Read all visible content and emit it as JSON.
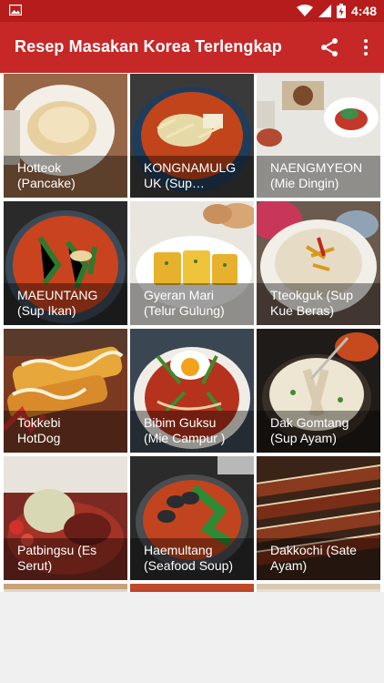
{
  "status_bar": {
    "time": "4:48",
    "icons": [
      "image-icon",
      "wifi-icon",
      "signal-icon",
      "battery-icon"
    ]
  },
  "app_bar": {
    "title": "Resep Masakan Korea Terlengkap",
    "actions": [
      "share-icon",
      "more-vert-icon"
    ]
  },
  "colors": {
    "status_bar": "#b71c1c",
    "app_bar": "#c62828",
    "background": "#f0f0f0"
  },
  "recipes": [
    {
      "label": "Hotteok\n(Pancake)"
    },
    {
      "label": "KONGNAMULG\nUK (Sup…"
    },
    {
      "label": "NAENGMYEON\n(Mie Dingin)"
    },
    {
      "label": "MAEUNTANG\n(Sup Ikan)"
    },
    {
      "label": "Gyeran Mari\n(Telur Gulung)"
    },
    {
      "label": "Tteokguk (Sup\nKue Beras)"
    },
    {
      "label": "Tokkebi\nHotDog"
    },
    {
      "label": "Bibim Guksu\n(Mie Campur )"
    },
    {
      "label": "Dak Gomtang\n(Sup Ayam)"
    },
    {
      "label": "Patbingsu (Es\nSerut)"
    },
    {
      "label": "Haemultang\n(Seafood Soup)"
    },
    {
      "label": "Dakkochi (Sate\nAyam)"
    }
  ]
}
